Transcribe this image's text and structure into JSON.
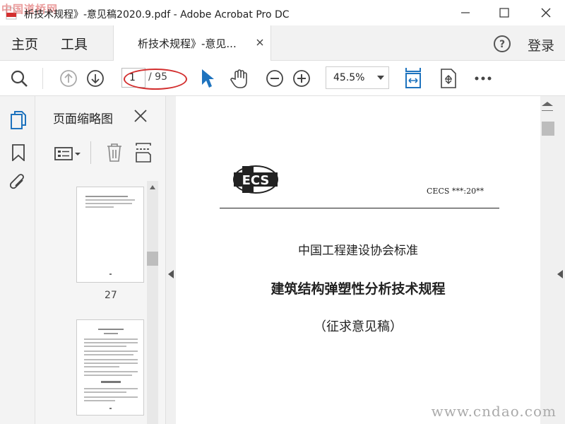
{
  "watermark_top": "中国道桥网",
  "watermark_bottom": "www.cndao.com",
  "window": {
    "title": "析技术规程》-意见稿2020.9.pdf - Adobe Acrobat Pro DC"
  },
  "tabbar": {
    "home": "主页",
    "tools": "工具",
    "doc_tab": "析技术规程》-意见...",
    "login": "登录"
  },
  "toolbar": {
    "page_current": "1",
    "page_total": "/ 95",
    "zoom": "45.5%"
  },
  "thumbs": {
    "title": "页面缩略图",
    "page_label": "27"
  },
  "document": {
    "code": "CECS ***:20**",
    "org": "中国工程建设协会标准",
    "title": "建筑结构弹塑性分析技术规程",
    "subtitle": "（征求意见稿）",
    "logo_text": "ECS"
  },
  "colors": {
    "accent": "#1e73be",
    "highlight": "#d32f2f"
  }
}
